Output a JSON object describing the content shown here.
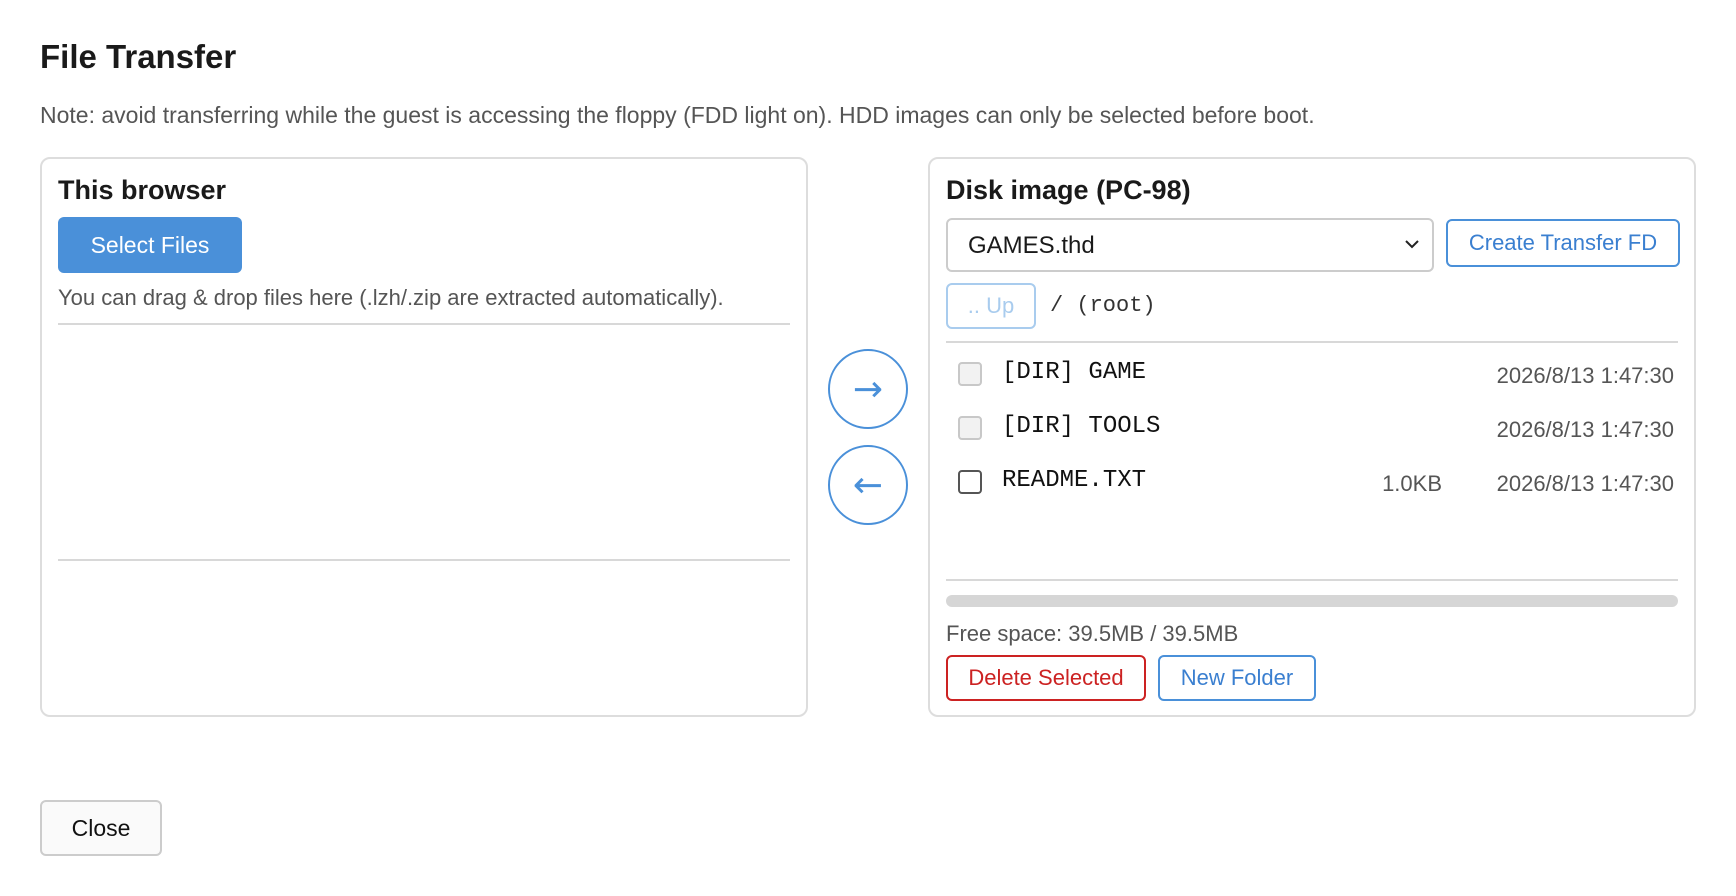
{
  "dialog": {
    "title": "File Transfer",
    "note": "Note: avoid transferring while the guest is accessing the floppy (FDD light on). HDD images can only be selected before boot.",
    "close_label": "Close"
  },
  "browser_panel": {
    "title": "This browser",
    "select_files_label": "Select Files",
    "hint": "You can drag & drop files here (.lzh/.zip are extracted automatically)."
  },
  "transfer": {
    "to_disk_icon": "arrow-right-icon",
    "to_disk_glyph": "→",
    "to_browser_icon": "arrow-left-icon",
    "to_browser_glyph": "←"
  },
  "disk_panel": {
    "title": "Disk image (PC-98)",
    "selected_image": "GAMES.thd",
    "create_transfer_label": "Create Transfer FD",
    "up_label": ".. Up",
    "path": "/ (root)",
    "files": [
      {
        "name": "[DIR] GAME",
        "size": "",
        "date": "2026/8/13 1:47:30",
        "checkbox_enabled": false
      },
      {
        "name": "[DIR] TOOLS",
        "size": "",
        "date": "2026/8/13 1:47:30",
        "checkbox_enabled": false
      },
      {
        "name": "README.TXT",
        "size": "1.0KB",
        "date": "2026/8/13 1:47:30",
        "checkbox_enabled": true
      }
    ],
    "usage_fraction": 0,
    "free_space": "Free space: 39.5MB / 39.5MB",
    "delete_label": "Delete Selected",
    "new_folder_label": "New Folder"
  },
  "colors": {
    "accent": "#4a90d9",
    "danger": "#cc2222",
    "border": "#dddddd"
  }
}
